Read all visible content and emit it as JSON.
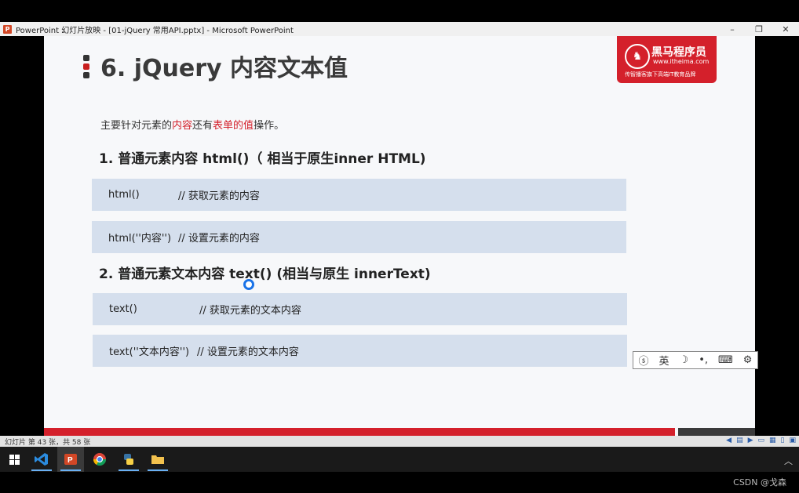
{
  "window": {
    "title": "PowerPoint 幻灯片放映 - [01-jQuery 常用API.pptx] - Microsoft PowerPoint",
    "app_icon_letter": "P",
    "minimize": "–",
    "restore": "❐",
    "close": "✕"
  },
  "slide": {
    "title": "6. jQuery 内容文本值",
    "logo": {
      "name": "黑马程序员",
      "url": "www.itheima.com",
      "tagline": "传智播客旗下高端IT教育品牌"
    },
    "intro": {
      "part1": "主要针对元素的",
      "highlight1": "内容",
      "part2": "还有",
      "highlight2": "表单的值",
      "part3": "操作。"
    },
    "section1": "1. 普通元素内容 html()（ 相当于原生inner HTML)",
    "code1": [
      {
        "code": "html()",
        "comment": "// 获取元素的内容"
      },
      {
        "code": "html(''内容'')",
        "comment": "// 设置元素的内容"
      }
    ],
    "section2": "2. 普通元素文本内容 text()   (相当与原生 innerText)",
    "code2": [
      {
        "code": "text()",
        "comment": "// 获取元素的文本内容"
      },
      {
        "code": "text(''文本内容'')",
        "comment": "// 设置元素的文本内容"
      }
    ]
  },
  "ime": {
    "lang": "英",
    "icons": [
      "ime-logo-icon",
      "moon-icon",
      "punctuation-icon",
      "keyboard-icon",
      "gear-icon"
    ]
  },
  "status": {
    "slide_count": "幻灯片 第 43 张，共 58 张"
  },
  "taskbar": {
    "apps": [
      "vscode-icon",
      "powerpoint-icon",
      "chrome-icon",
      "python-icon",
      "folder-icon"
    ]
  },
  "watermark": "CSDN @戈森",
  "colors": {
    "accent_red": "#d4202b",
    "code_box": "#d5dfed"
  }
}
